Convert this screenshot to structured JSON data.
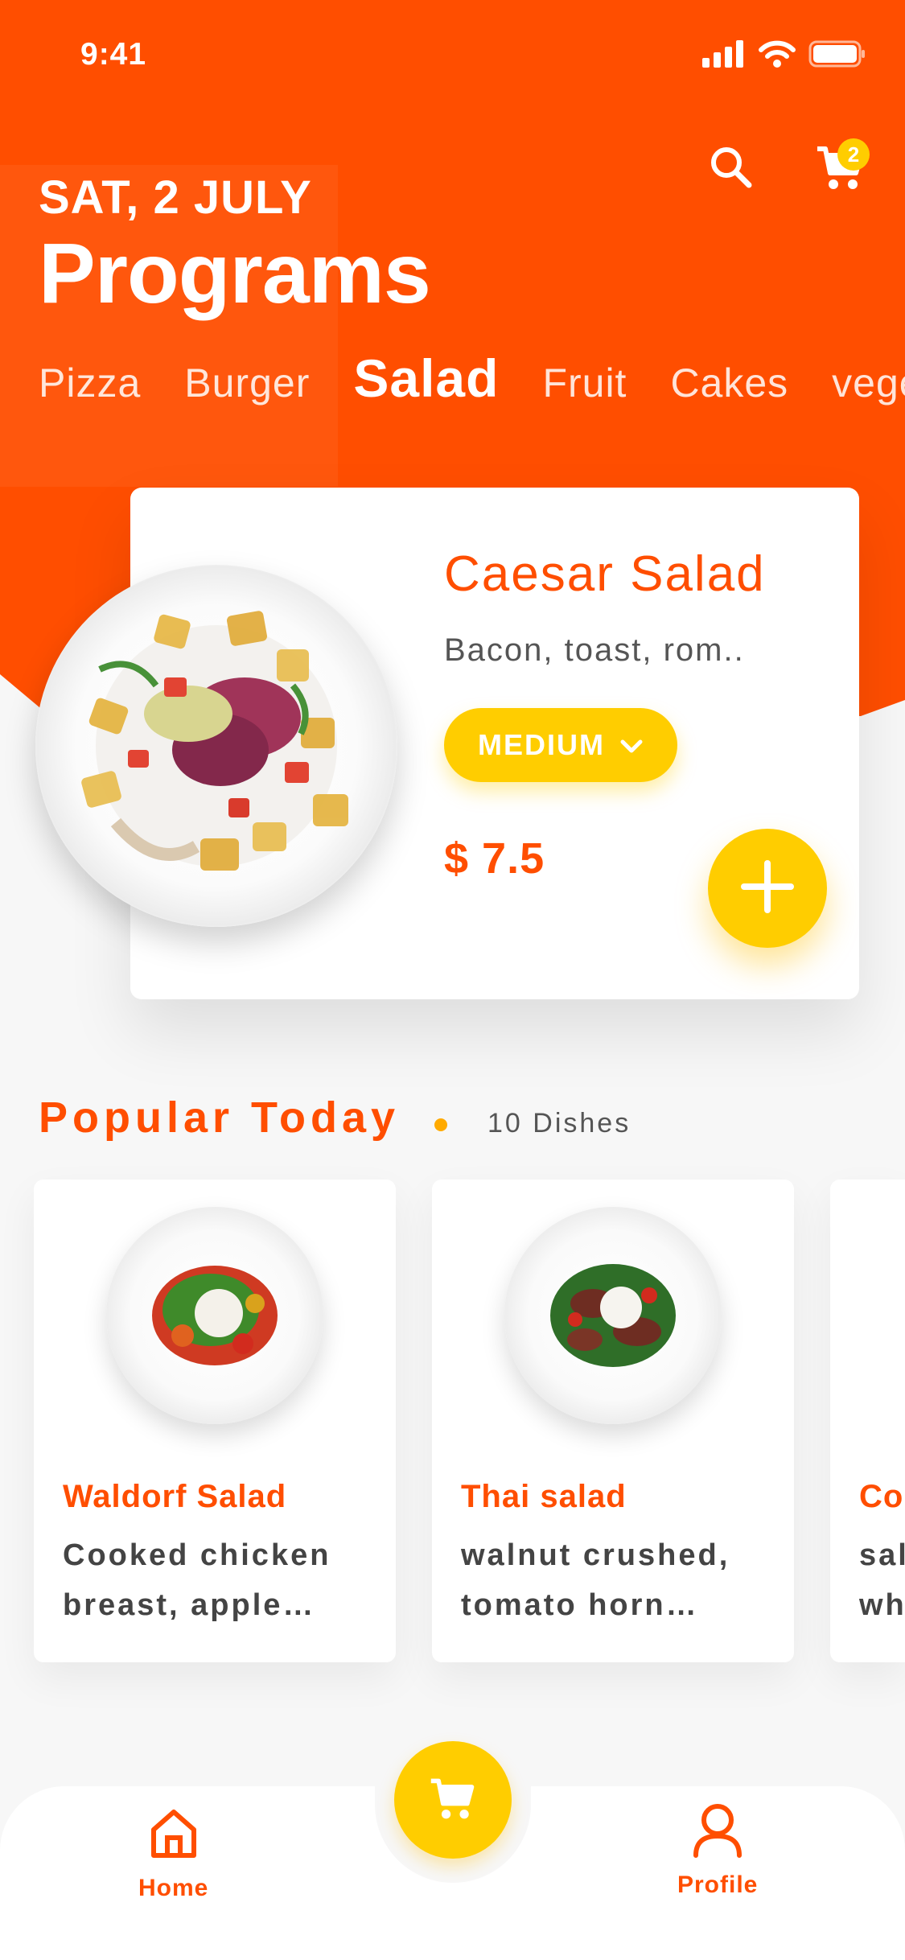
{
  "status_bar": {
    "time": "9:41"
  },
  "header": {
    "date": "SAT, 2 JULY",
    "title": "Programs",
    "cart_count": "2"
  },
  "categories": [
    {
      "label": "Pizza"
    },
    {
      "label": "Burger"
    },
    {
      "label": "Salad",
      "active": true
    },
    {
      "label": "Fruit"
    },
    {
      "label": "Cakes"
    },
    {
      "label": "vege"
    }
  ],
  "featured": {
    "name": "Caesar Salad",
    "description": "Bacon, toast, rom..",
    "size": "MEDIUM",
    "price": "$ 7.5"
  },
  "popular": {
    "title": "Popular Today",
    "count": "10 Dishes",
    "dishes": [
      {
        "name": "Waldorf Salad",
        "desc_line1": "Cooked chicken",
        "desc_line2": "breast, apple…"
      },
      {
        "name": "Thai salad",
        "desc_line1": "walnut crushed,",
        "desc_line2": "tomato horn…"
      },
      {
        "name": "Co",
        "desc_line1": "sal",
        "desc_line2": "wh"
      }
    ]
  },
  "nav": {
    "home_label": "Home",
    "profile_label": "Profile"
  },
  "colors": {
    "accent": "#ff4e00",
    "yellow": "#ffcd00",
    "background": "#f7f7f7"
  },
  "icons": [
    "signal-icon",
    "wifi-icon",
    "battery-icon",
    "search-icon",
    "cart-icon",
    "chevron-down-icon",
    "plus-icon",
    "home-icon",
    "profile-icon"
  ]
}
